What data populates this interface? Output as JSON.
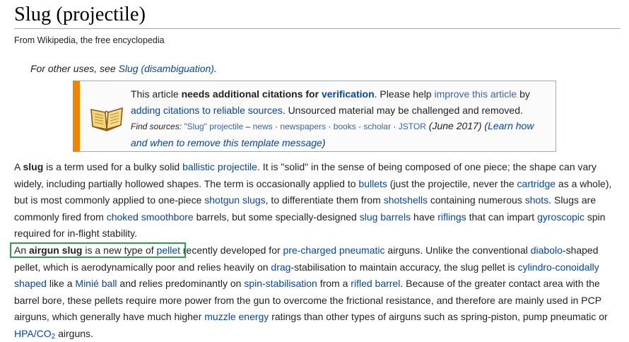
{
  "page": {
    "title": "Slug (projectile)",
    "from": "From Wikipedia, the free encyclopedia"
  },
  "hatnote": {
    "prefix": "For other uses, see ",
    "link": "Slug (disambiguation)",
    "suffix": "."
  },
  "ambox": {
    "icon": "book-icon",
    "accent_color": "#f28500",
    "t1": "This article ",
    "t2": "needs additional citations for ",
    "t3": "verification",
    "t4": ". Please help ",
    "t5": "improve this article",
    "t6": " by",
    "t7": "adding citations to reliable sources",
    "t8": ". Unsourced material may be challenged and removed.",
    "find_label": "Find sources:",
    "find_query": "\"Slug\" projectile",
    "dash": " – ",
    "src_news": "news",
    "src_newspapers": "newspapers",
    "src_books": "books",
    "src_scholar": "scholar",
    "src_jstor": "JSTOR",
    "sep": " · ",
    "date": " (June 2017) (",
    "learn": "Learn how and when to remove this template message",
    "close_paren": ")"
  },
  "para1": {
    "s1": "A ",
    "b1": "slug",
    "s2": " is a term used for a bulky solid ",
    "l_ballistic": "ballistic",
    "s3": " ",
    "l_projectile": "projectile",
    "s4": ". It is \"solid\" in the sense of being composed of one piece; the shape can vary widely, including partially hollowed shapes. The term is occasionally applied to ",
    "l_bullets": "bullets",
    "s5": " (just the projectile, never the ",
    "l_cartridge": "cartridge",
    "s6": " as a whole), but is most commonly applied to one-piece ",
    "l_shotgun_slugs": "shotgun slugs",
    "s7": ", to differentiate them from ",
    "l_shotshells": "shotshells",
    "s8": " containing numerous ",
    "l_shots": "shots",
    "s9": ". Slugs are commonly fired from ",
    "l_choked": "choked",
    "s10": " ",
    "l_smoothbore": "smoothbore",
    "s11": " barrels, but some specially-designed ",
    "l_slug_barrels": "slug barrels",
    "s12": " have ",
    "l_riflings": "riflings",
    "s13": " that can impart ",
    "l_gyroscopic": "gyroscopic",
    "s14": " spin required for in-flight stability."
  },
  "para2": {
    "s1": "An ",
    "b1": "airgun slug",
    "s2": " is a new type of ",
    "l_pellet": "pellet",
    "s3": " recently developed for ",
    "l_pcp": "pre-charged pneumatic",
    "s4": " airguns. Unlike the conventional ",
    "l_diabolo": "diabolo",
    "s5": "-shaped pellet, which is aerodynamically poor and relies heavily on ",
    "l_drag": "drag",
    "s6": "-stabilisation to maintain accuracy, the slug pellet is ",
    "l_cylindro": "cylindro-conoidally shaped",
    "s7": " like a ",
    "l_minie": "Minié ball",
    "s8": " and relies predominantly on ",
    "l_spin": "spin-stabilisation",
    "s9": " from a ",
    "l_rifled": "rifled barrel",
    "s10": ". Because of the greater contact area with the barrel bore, these pellets require more power from the gun to overcome the frictional resistance, and therefore are mainly used in PCP airguns, which generally have much higher ",
    "l_muzzle": "muzzle energy",
    "s11": " ratings than other types of airguns such as spring-piston, pump pneumatic or ",
    "l_hpa": "HPA/CO",
    "l_hpa_sub": "2",
    "s12": " airguns."
  },
  "highlight": {
    "color": "#2e9e4a"
  }
}
